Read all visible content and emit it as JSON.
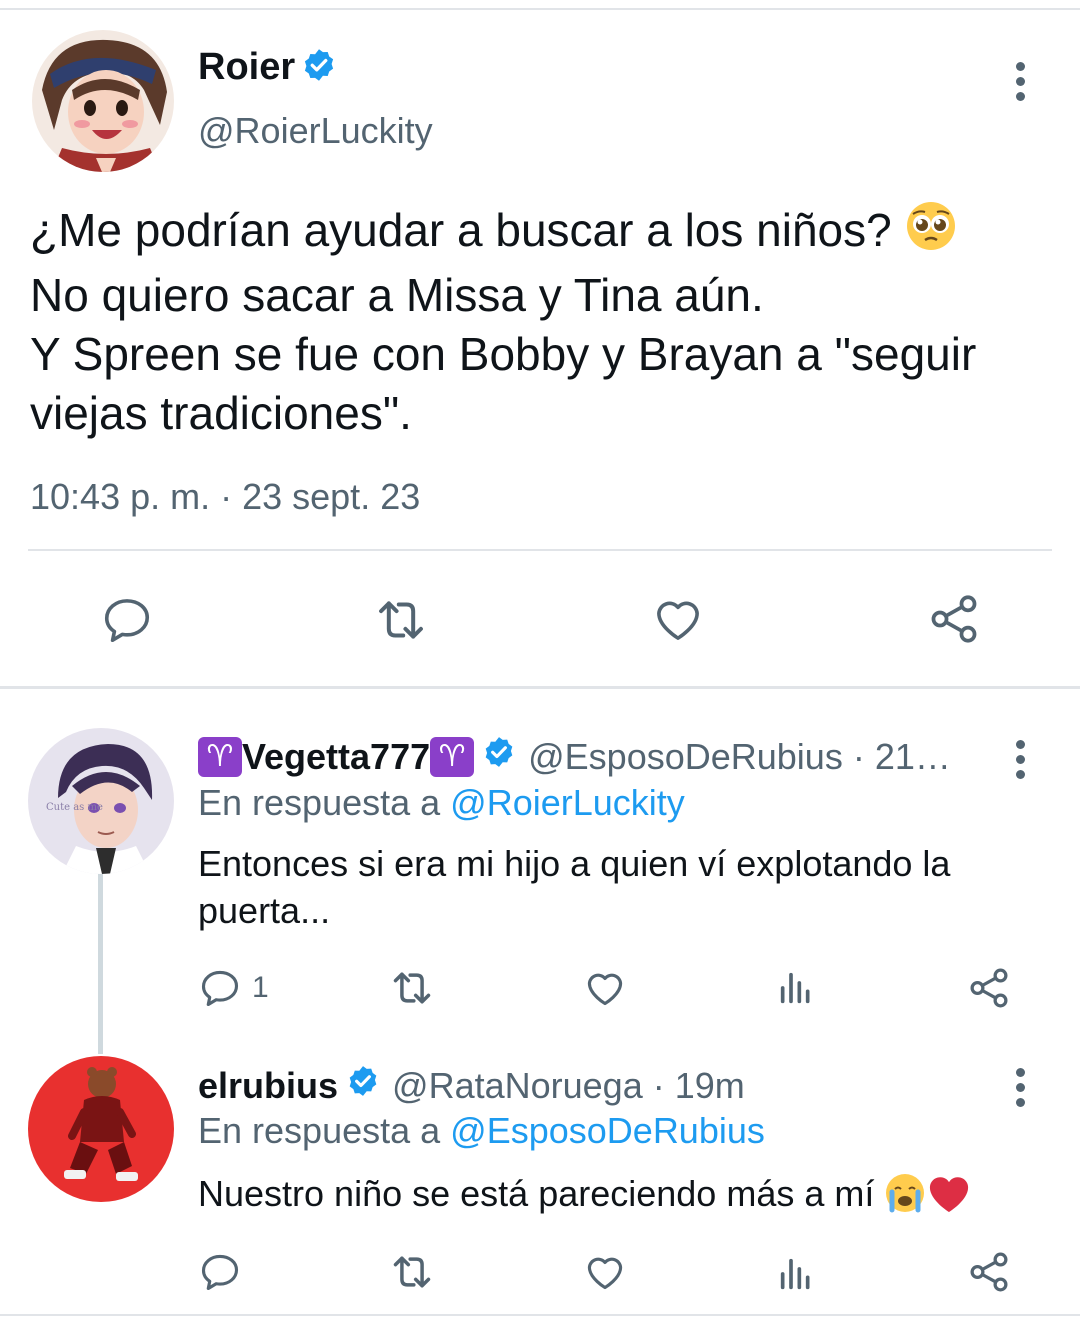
{
  "main_tweet": {
    "name": "Roier",
    "handle": "@RoierLuckity",
    "text_lines": [
      "¿Me podrían ayudar a buscar a los niños?",
      "No quiero sacar a Missa y Tina aún.",
      "Y Spreen se fue con Bobby y Brayan a \"seguir",
      "viejas tradiciones\"."
    ],
    "timestamp": "10:43 p. m. · 23 sept. 23",
    "emoji": "pleading-face"
  },
  "replies": [
    {
      "name": "Vegetta777",
      "name_decoration": "♈",
      "handle_time": "@EsposoDeRubius · 21…",
      "reply_to_prefix": "En respuesta a ",
      "reply_to_handle": "@RoierLuckity",
      "text": "Entonces si era mi hijo a quien ví explotando la puerta...",
      "reply_count": "1"
    },
    {
      "name": "elrubius",
      "handle_time": "@RataNoruega · 19m",
      "reply_to_prefix": "En respuesta a ",
      "reply_to_handle": "@EsposoDeRubius",
      "text": "Nuestro niño se está pareciendo más a mí",
      "emojis": [
        "crying-face",
        "red-heart"
      ]
    }
  ],
  "colors": {
    "text": "#0f1419",
    "secondary": "#536471",
    "link": "#1d9bf0",
    "divider": "#e1e4e8",
    "verified": "#1d9bf0"
  },
  "icons": {
    "actions": [
      "reply-icon",
      "retweet-icon",
      "like-icon",
      "views-icon",
      "share-icon"
    ]
  }
}
